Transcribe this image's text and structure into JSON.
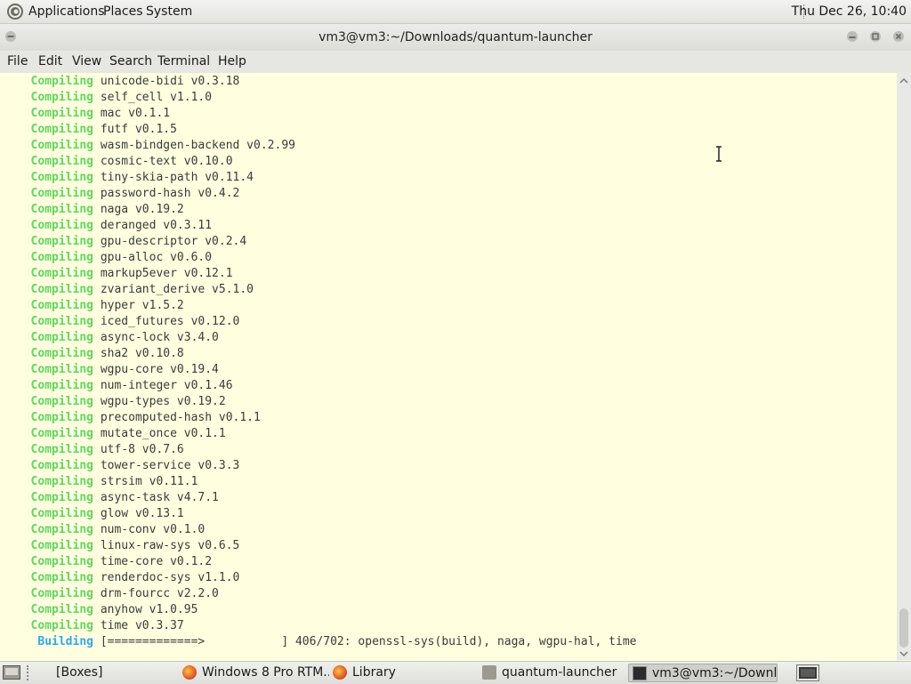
{
  "top_panel": {
    "menus": [
      "Applications",
      "Places",
      "System"
    ],
    "clock": "Thu Dec 26, 10:40"
  },
  "window": {
    "title": "vm3@vm3:~/Downloads/quantum-launcher"
  },
  "menubar": [
    "File",
    "Edit",
    "View",
    "Search",
    "Terminal",
    "Help"
  ],
  "terminal": {
    "lines": [
      {
        "status": "Compiling",
        "text": "unicode-bidi v0.3.18"
      },
      {
        "status": "Compiling",
        "text": "self_cell v1.1.0"
      },
      {
        "status": "Compiling",
        "text": "mac v0.1.1"
      },
      {
        "status": "Compiling",
        "text": "futf v0.1.5"
      },
      {
        "status": "Compiling",
        "text": "wasm-bindgen-backend v0.2.99"
      },
      {
        "status": "Compiling",
        "text": "cosmic-text v0.10.0"
      },
      {
        "status": "Compiling",
        "text": "tiny-skia-path v0.11.4"
      },
      {
        "status": "Compiling",
        "text": "password-hash v0.4.2"
      },
      {
        "status": "Compiling",
        "text": "naga v0.19.2"
      },
      {
        "status": "Compiling",
        "text": "deranged v0.3.11"
      },
      {
        "status": "Compiling",
        "text": "gpu-descriptor v0.2.4"
      },
      {
        "status": "Compiling",
        "text": "gpu-alloc v0.6.0"
      },
      {
        "status": "Compiling",
        "text": "markup5ever v0.12.1"
      },
      {
        "status": "Compiling",
        "text": "zvariant_derive v5.1.0"
      },
      {
        "status": "Compiling",
        "text": "hyper v1.5.2"
      },
      {
        "status": "Compiling",
        "text": "iced_futures v0.12.0"
      },
      {
        "status": "Compiling",
        "text": "async-lock v3.4.0"
      },
      {
        "status": "Compiling",
        "text": "sha2 v0.10.8"
      },
      {
        "status": "Compiling",
        "text": "wgpu-core v0.19.4"
      },
      {
        "status": "Compiling",
        "text": "num-integer v0.1.46"
      },
      {
        "status": "Compiling",
        "text": "wgpu-types v0.19.2"
      },
      {
        "status": "Compiling",
        "text": "precomputed-hash v0.1.1"
      },
      {
        "status": "Compiling",
        "text": "mutate_once v0.1.1"
      },
      {
        "status": "Compiling",
        "text": "utf-8 v0.7.6"
      },
      {
        "status": "Compiling",
        "text": "tower-service v0.3.3"
      },
      {
        "status": "Compiling",
        "text": "strsim v0.11.1"
      },
      {
        "status": "Compiling",
        "text": "async-task v4.7.1"
      },
      {
        "status": "Compiling",
        "text": "glow v0.13.1"
      },
      {
        "status": "Compiling",
        "text": "num-conv v0.1.0"
      },
      {
        "status": "Compiling",
        "text": "linux-raw-sys v0.6.5"
      },
      {
        "status": "Compiling",
        "text": "time-core v0.1.2"
      },
      {
        "status": "Compiling",
        "text": "renderdoc-sys v1.1.0"
      },
      {
        "status": "Compiling",
        "text": "drm-fourcc v2.2.0"
      },
      {
        "status": "Compiling",
        "text": "anyhow v1.0.95"
      },
      {
        "status": "Compiling",
        "text": "time v0.3.37"
      },
      {
        "status": "Building",
        "text": "[=============>           ] 406/702: openssl-sys(build), naga, wgpu-hal, time"
      }
    ],
    "colors": {
      "compiling": "#5fd75f",
      "building": "#2ea8ee",
      "background": "#ffffe0",
      "text": "#3a3a3a"
    }
  },
  "taskbar": {
    "tasks": [
      {
        "label": "[Boxes]",
        "icon": "none"
      },
      {
        "label": "Windows 8 Pro RTM...",
        "icon": "firefox-icon"
      },
      {
        "label": "Library",
        "icon": "firefox-icon"
      },
      {
        "label": "quantum-launcher",
        "icon": "folder-icon"
      },
      {
        "label": "vm3@vm3:~/Downl...",
        "icon": "terminal-icon",
        "active": true
      }
    ]
  }
}
